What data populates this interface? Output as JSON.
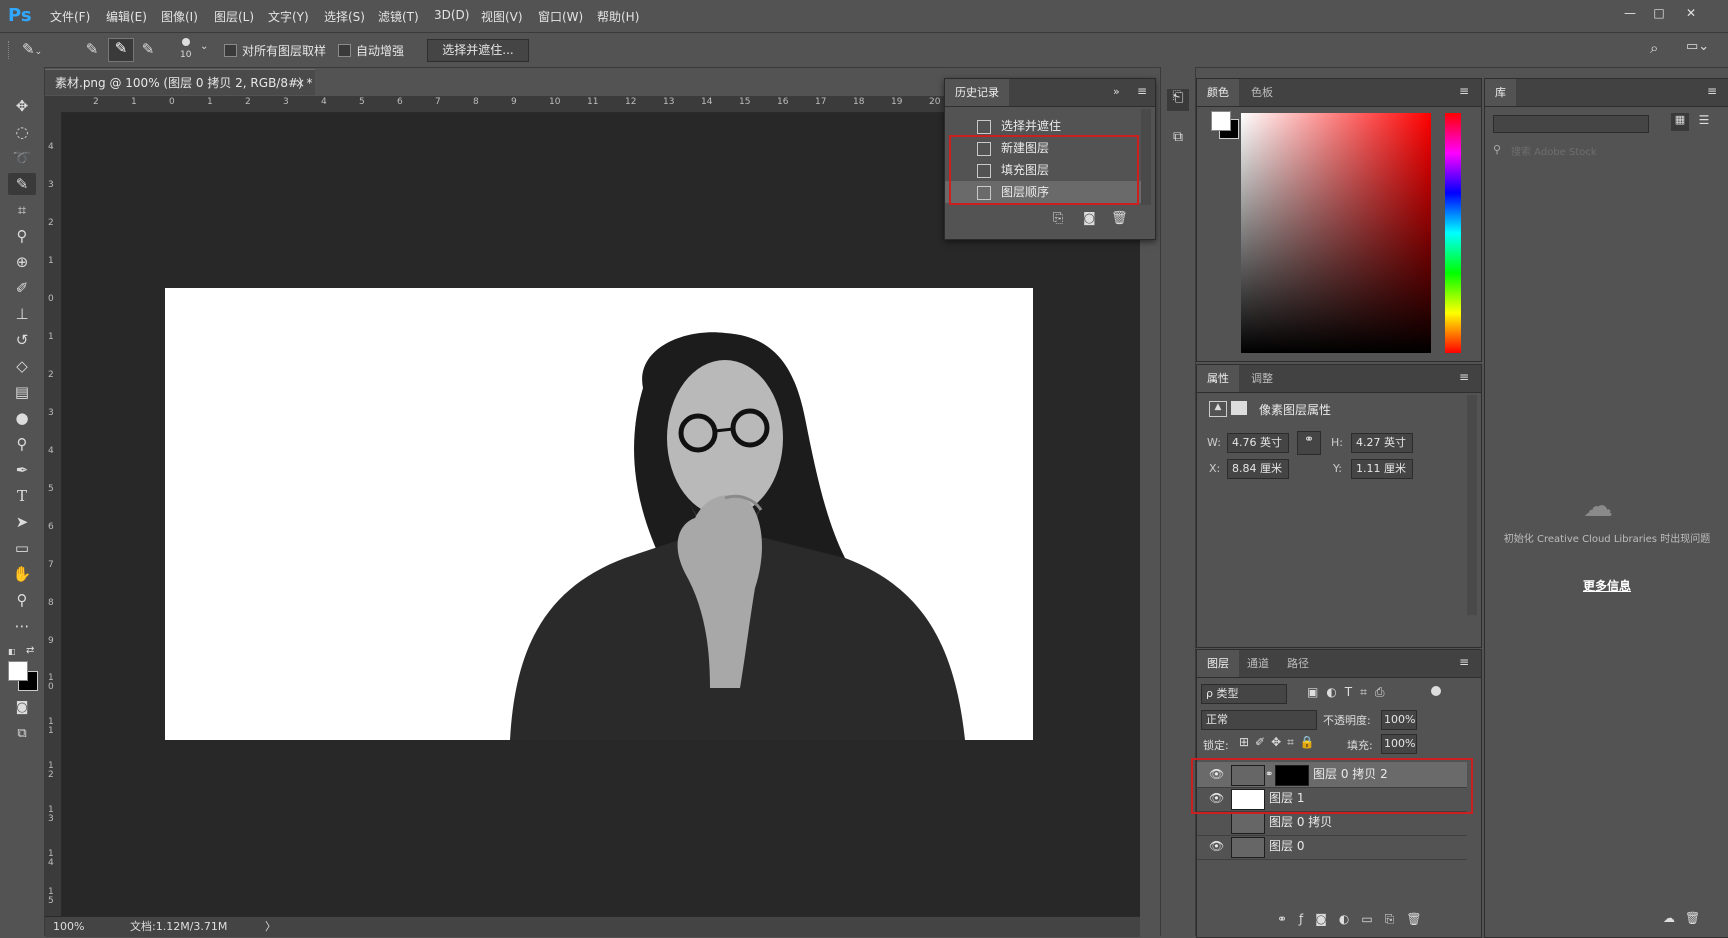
{
  "app": {
    "logo": "Ps"
  },
  "menu": [
    "文件(F)",
    "编辑(E)",
    "图像(I)",
    "图层(L)",
    "文字(Y)",
    "选择(S)",
    "滤镜(T)",
    "3D(D)",
    "视图(V)",
    "窗口(W)",
    "帮助(H)"
  ],
  "window_controls": {
    "minimize": "—",
    "restore": "□",
    "close": "✕"
  },
  "options": {
    "brush_size": "10",
    "sample_all_layers": "对所有图层取样",
    "auto_enhance": "自动增强",
    "select_mask_button": "选择并遮住..."
  },
  "document": {
    "tab_title": "素材.png @ 100% (图层 0 拷贝 2, RGB/8#) *",
    "tab_close": "×",
    "zoom": "100%",
    "doc_info": "文档:1.12M/3.71M",
    "status_arrow": "〉",
    "ruler_top": [
      "2",
      "1",
      "0",
      "1",
      "2",
      "3",
      "4",
      "5",
      "6",
      "7",
      "8",
      "9",
      "10",
      "11",
      "12",
      "13",
      "14",
      "15",
      "16",
      "17",
      "18",
      "19",
      "20"
    ],
    "ruler_left": [
      "4",
      "3",
      "2",
      "1",
      "0",
      "1",
      "2",
      "3",
      "4",
      "5",
      "6",
      "7",
      "8",
      "9",
      "1 0",
      "1 1",
      "1 2",
      "1 3",
      "1 4",
      "1 5"
    ]
  },
  "history": {
    "tab": "历史记录",
    "items": [
      "选择并遮住",
      "新建图层",
      "填充图层",
      "图层顺序"
    ]
  },
  "color_panel": {
    "tabs": [
      "颜色",
      "色板"
    ]
  },
  "properties_panel": {
    "tabs": [
      "属性",
      "调整"
    ],
    "heading": "像素图层属性",
    "w_label": "W:",
    "w_value": "4.76 英寸",
    "h_label": "H:",
    "h_value": "4.27 英寸",
    "x_label": "X:",
    "x_value": "8.84 厘米",
    "y_label": "Y:",
    "y_value": "1.11 厘米"
  },
  "layers_panel": {
    "tabs": [
      "图层",
      "通道",
      "路径"
    ],
    "filter_type": "ρ 类型",
    "blend_mode": "正常",
    "opacity_label": "不透明度:",
    "opacity_value": "100%",
    "lock_label": "锁定:",
    "fill_label": "填充:",
    "fill_value": "100%",
    "layers": [
      {
        "name": "图层 0 拷贝 2",
        "visible": true
      },
      {
        "name": "图层 1",
        "visible": true
      },
      {
        "name": "图层 0 拷贝",
        "visible": false
      },
      {
        "name": "图层 0",
        "visible": true
      }
    ]
  },
  "library_panel": {
    "tab": "库",
    "search_placeholder": "搜索 Adobe Stock",
    "message": "初始化 Creative Cloud Libraries 时出现问题",
    "more_link": "更多信息"
  }
}
